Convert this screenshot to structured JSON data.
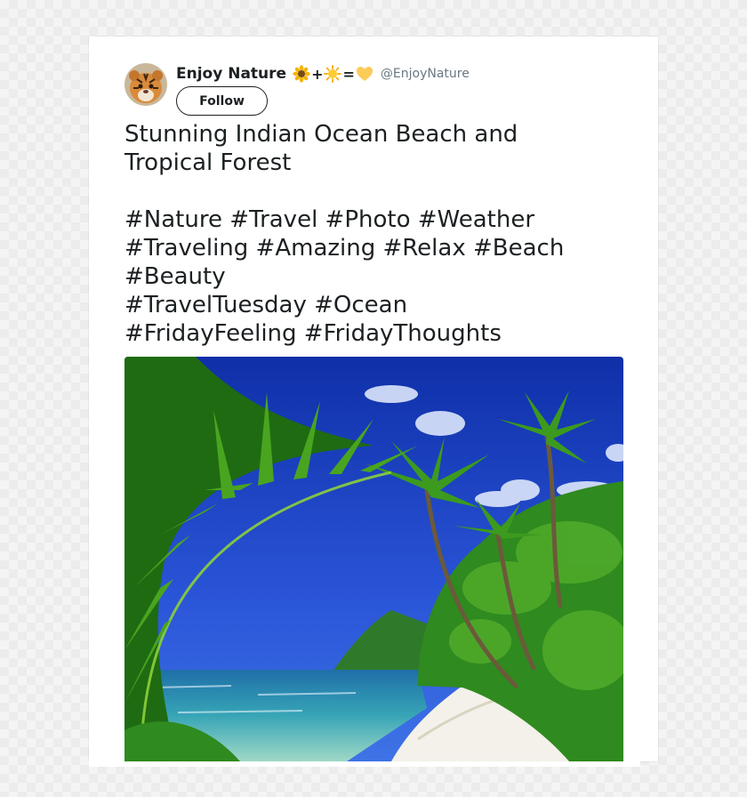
{
  "tweet": {
    "display_name": "Enjoy Nature",
    "name_emoji": {
      "icons": [
        "sunflower-icon",
        "sun-icon",
        "yellow-heart-icon"
      ],
      "plus": "+",
      "equals": "="
    },
    "handle": "@EnjoyNature",
    "follow_label": "Follow",
    "text_lines": [
      "Stunning Indian Ocean Beach and",
      "Tropical Forest",
      "",
      "#Nature #Travel #Photo #Weather",
      "#Traveling #Amazing #Relax #Beach",
      "#Beauty",
      "#TravelTuesday #Ocean",
      "#FridayFeeling #FridayThoughts"
    ],
    "avatar_icon": "tiger-cub-avatar",
    "photo_icon": "tropical-beach-photo"
  },
  "colors": {
    "text": "#1c2022",
    "handle": "#697882",
    "sky": "#1e3fbf",
    "foliage": "#2f8a1f",
    "sand": "#f3f1ea",
    "sea": "#3aa8b8"
  }
}
